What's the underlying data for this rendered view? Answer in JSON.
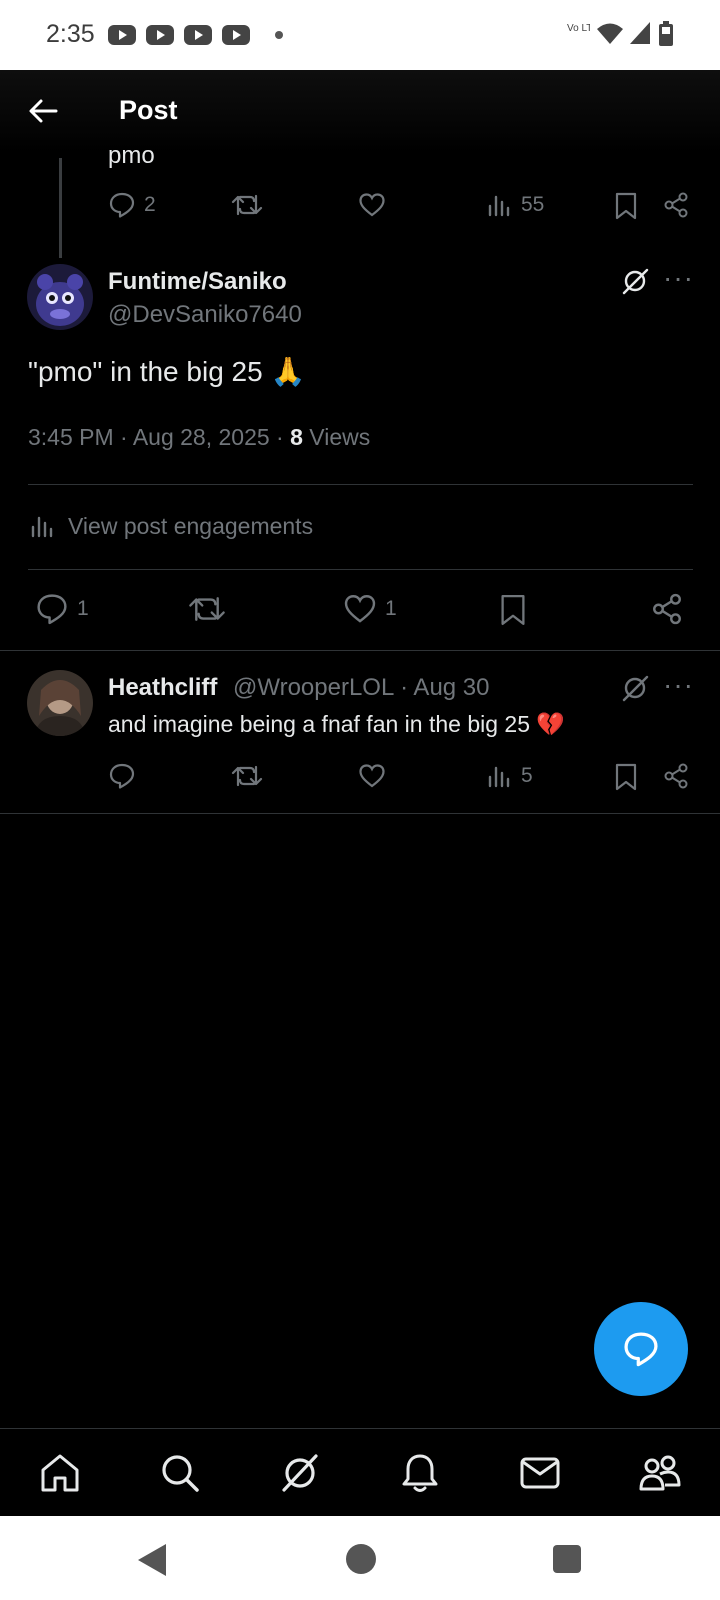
{
  "status_bar": {
    "time": "2:35",
    "network": "Vo LTE"
  },
  "header": {
    "title": "Post"
  },
  "previous_post": {
    "text": "pmo",
    "reply_count": "2",
    "view_count": "55"
  },
  "main_post": {
    "display_name": "Funtime/Saniko",
    "handle": "@DevSaniko7640",
    "text": "\"pmo\" in the big 25 🙏",
    "meta_prefix": "3:45 PM · Aug 28, 2025 · ",
    "views_count": "8",
    "views_label": " Views",
    "engagements_label": "View post engagements",
    "reply_count": "1",
    "like_count": "1"
  },
  "reply_post": {
    "display_name": "Heathcliff",
    "handle_date": "@WrooperLOL · Aug 30",
    "text": "and imagine being a fnaf fan in the big 25 💔",
    "view_count": "5"
  },
  "colors": {
    "accent": "#1d9bf0",
    "muted": "#71767b",
    "text": "#e7e9ea",
    "background": "#000000"
  }
}
